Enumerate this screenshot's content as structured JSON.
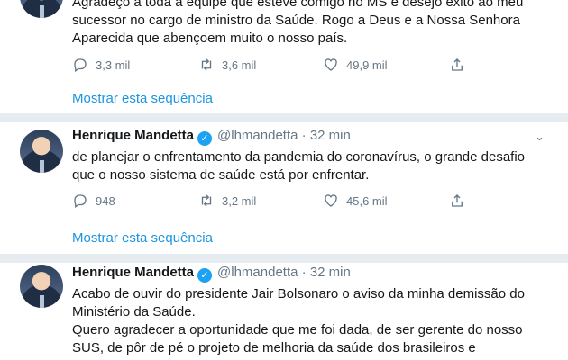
{
  "tweets": [
    {
      "text_lines": [
        "Agradeço a toda a equipe que esteve comigo no MS e desejo êxito ao meu",
        "sucessor no cargo de ministro da Saúde. Rogo a Deus e a Nossa Senhora",
        "Aparecida que abençoem muito o nosso país."
      ],
      "replies": "3,3 mil",
      "retweets": "3,6 mil",
      "likes": "49,9 mil",
      "show_thread": "Mostrar esta sequência"
    },
    {
      "name": "Henrique Mandetta",
      "handle": "@lhmandetta",
      "separator": "·",
      "time": "32 min",
      "text_lines": [
        "de planejar o enfrentamento da pandemia do coronavírus, o grande desafio",
        "que o nosso sistema de saúde está por enfrentar."
      ],
      "replies": "948",
      "retweets": "3,2 mil",
      "likes": "45,6 mil",
      "show_thread": "Mostrar esta sequência"
    },
    {
      "name": "Henrique Mandetta",
      "handle": "@lhmandetta",
      "separator": "·",
      "time": "32 min",
      "text_lines": [
        "Acabo de ouvir do presidente Jair Bolsonaro o aviso da minha demissão do",
        "Ministério da Saúde.",
        "Quero agradecer a oportunidade que me foi dada, de ser gerente do nosso",
        "SUS, de pôr de pé o projeto de melhoria da saúde dos brasileiros e"
      ]
    }
  ],
  "icons": {
    "reply": "reply-icon",
    "retweet": "retweet-icon",
    "like": "heart-icon",
    "share": "share-icon",
    "verified": "verified-badge-icon",
    "caret": "chevron-down-icon"
  },
  "colors": {
    "link": "#1b95e0",
    "verified": "#1da1f2",
    "muted": "#657786",
    "separator": "#e6ecf0"
  }
}
